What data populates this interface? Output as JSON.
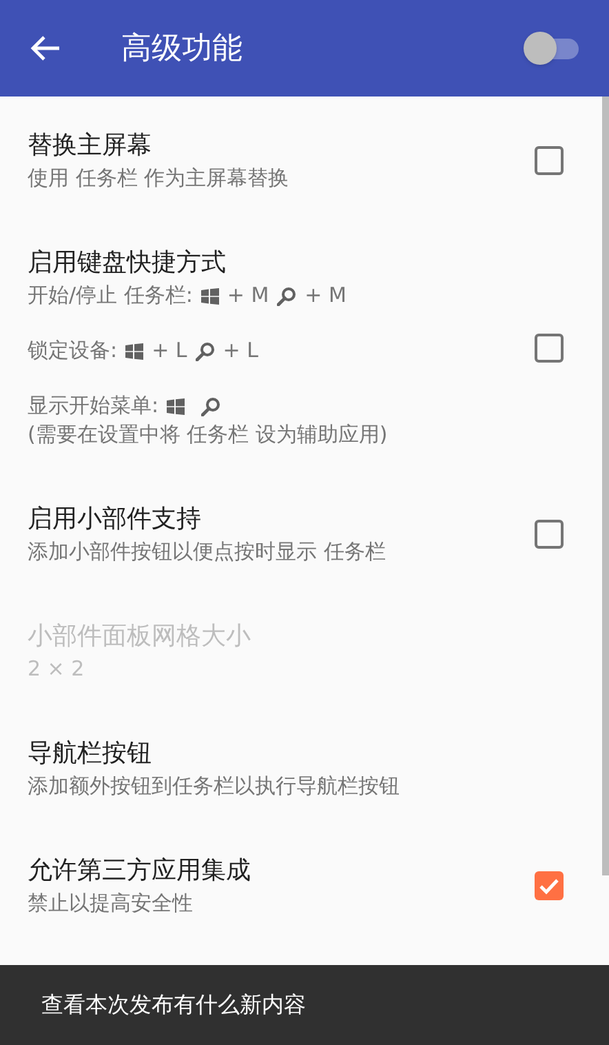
{
  "toolbar": {
    "title": "高级功能",
    "switch": {
      "on": false
    }
  },
  "settings": [
    {
      "kind": "checkbox",
      "title": "替换主屏幕",
      "checked": false,
      "disabled": false,
      "groups": [
        [
          [
            {
              "kind": "text",
              "text": "使用 任务栏 作为主屏幕替换"
            }
          ]
        ]
      ]
    },
    {
      "kind": "checkbox",
      "title": "启用键盘快捷方式",
      "checked": false,
      "disabled": false,
      "groups": [
        [
          [
            {
              "kind": "text",
              "text": "开始/停止 任务栏:"
            },
            {
              "kind": "windows"
            },
            {
              "kind": "text",
              "text": "+ M"
            },
            {
              "kind": "search"
            },
            {
              "kind": "text",
              "text": "+ M"
            }
          ]
        ],
        [
          [
            {
              "kind": "text",
              "text": "锁定设备:"
            },
            {
              "kind": "windows"
            },
            {
              "kind": "text",
              "text": "+ L"
            },
            {
              "kind": "search"
            },
            {
              "kind": "text",
              "text": "+ L"
            }
          ]
        ],
        [
          [
            {
              "kind": "text",
              "text": "显示开始菜单:"
            },
            {
              "kind": "windows"
            },
            {
              "kind": "search"
            }
          ],
          [
            {
              "kind": "text",
              "text": "(需要在设置中将 任务栏 设为辅助应用)"
            }
          ]
        ]
      ]
    },
    {
      "kind": "checkbox",
      "title": "启用小部件支持",
      "checked": false,
      "disabled": false,
      "groups": [
        [
          [
            {
              "kind": "text",
              "text": "添加小部件按钮以便点按时显示 任务栏"
            }
          ]
        ]
      ]
    },
    {
      "kind": "plain",
      "title": "小部件面板网格大小",
      "disabled": true,
      "groups": [
        [
          [
            {
              "kind": "text",
              "text": "2 × 2"
            }
          ]
        ]
      ]
    },
    {
      "kind": "plain",
      "title": "导航栏按钮",
      "disabled": false,
      "groups": [
        [
          [
            {
              "kind": "text",
              "text": "添加额外按钮到任务栏以执行导航栏按钮"
            }
          ]
        ]
      ]
    },
    {
      "kind": "checkbox",
      "title": "允许第三方应用集成",
      "checked": true,
      "disabled": false,
      "groups": [
        [
          [
            {
              "kind": "text",
              "text": "禁止以提高安全性"
            }
          ]
        ]
      ]
    }
  ],
  "bottom_bar": {
    "text": "查看本次发布有什么新内容"
  }
}
